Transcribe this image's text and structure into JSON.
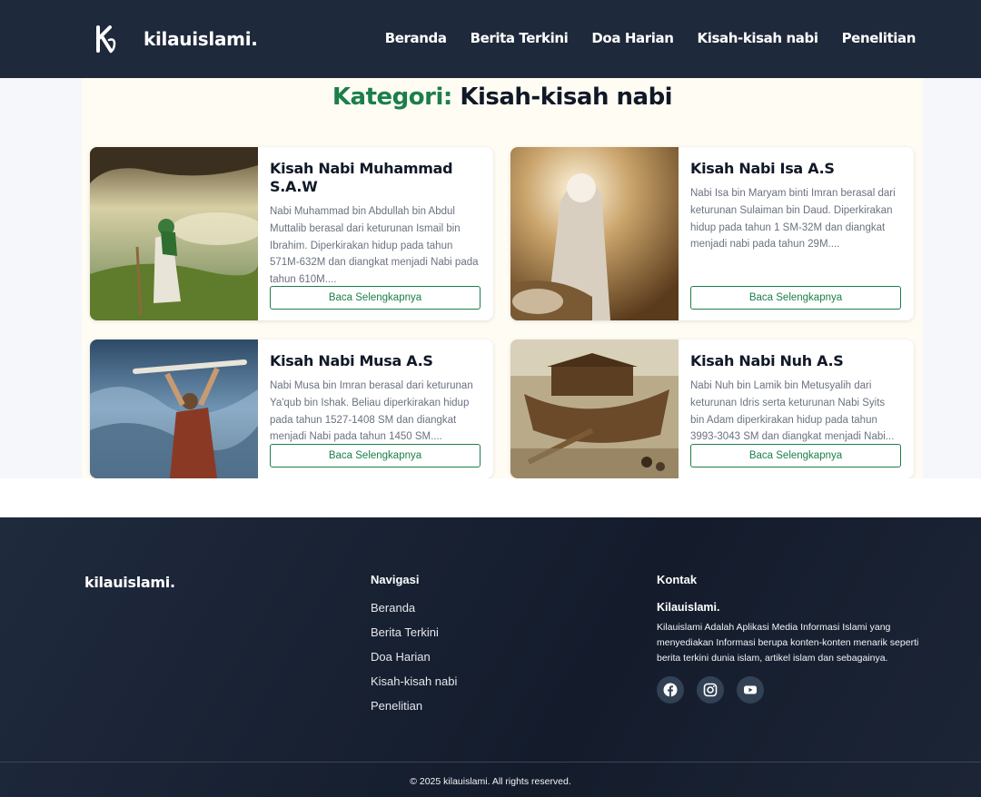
{
  "header": {
    "brand": "kilauislami.",
    "nav": [
      "Beranda",
      "Berita Terkini",
      "Doa Harian",
      "Kisah-kisah nabi",
      "Penelitian"
    ]
  },
  "page": {
    "title_prefix": "Kategori:",
    "title_category": "Kisah-kisah nabi"
  },
  "cards": [
    {
      "title": "Kisah Nabi Muhammad S.A.W",
      "excerpt": "Nabi Muhammad bin Abdullah bin Abdul Muttalib berasal dari keturunan Ismail bin Ibrahim. Diperkirakan hidup pada tahun 571M-632M dan diangkat menjadi Nabi pada tahun 610M....",
      "button": "Baca Selengkapnya"
    },
    {
      "title": "Kisah Nabi Isa A.S",
      "excerpt": "Nabi Isa bin Maryam binti Imran berasal dari keturunan Sulaiman bin Daud. Diperkirakan hidup pada tahun 1 SM-32M dan diangkat menjadi nabi pada tahun 29M....",
      "button": "Baca Selengkapnya"
    },
    {
      "title": "Kisah Nabi Musa A.S",
      "excerpt": "Nabi Musa bin Imran berasal dari keturunan Ya'qub bin Ishak. Beliau diperkirakan hidup pada tahun 1527-1408 SM dan diangkat menjadi Nabi pada tahun 1450 SM....",
      "button": "Baca Selengkapnya"
    },
    {
      "title": "Kisah Nabi Nuh A.S",
      "excerpt": "Nabi Nuh bin Lamik bin Metusyalih dari keturunan Idris serta keturunan Nabi Syits bin Adam diperkirakan hidup pada tahun 3993-3043 SM dan diangkat menjadi Nabi...",
      "button": "Baca Selengkapnya"
    }
  ],
  "footer": {
    "brand": "kilauislami.",
    "nav_title": "Navigasi",
    "nav_links": [
      "Beranda",
      "Berita Terkini",
      "Doa Harian",
      "Kisah-kisah nabi",
      "Penelitian"
    ],
    "contact_title": "Kontak",
    "contact_name": "Kilauislami.",
    "contact_desc": "Kilauislami Adalah Aplikasi Media Informasi Islami yang menyediakan Informasi berupa konten-konten menarik seperti berita terkini dunia islam, artikel islam dan sebagainya.",
    "socials": [
      "facebook-icon",
      "instagram-icon",
      "youtube-icon"
    ],
    "copyright": "© 2025 kilauislami. All rights reserved."
  },
  "colors": {
    "header_bg": "#1e293b",
    "accent_green": "#1b7f4a",
    "main_bg": "#fffcf4"
  }
}
